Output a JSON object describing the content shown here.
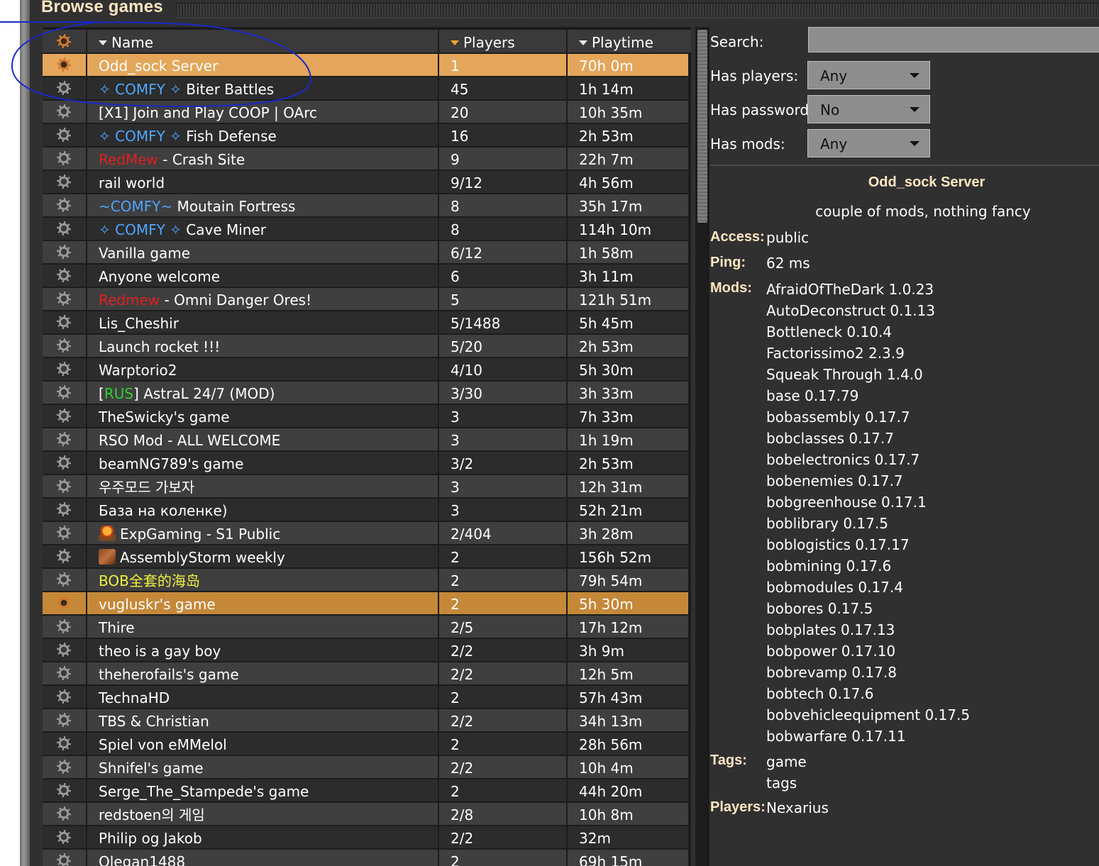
{
  "title": "Browse games",
  "table": {
    "headers": {
      "name": "Name",
      "players": "Players",
      "playtime": "Playtime"
    },
    "rows": [
      {
        "segments": [
          {
            "text": "Odd_sock Server"
          }
        ],
        "players": "1",
        "playtime": "70h 0m",
        "state": "selected"
      },
      {
        "segments": [
          {
            "text": "✧ COMFY ✧",
            "color": "blue"
          },
          {
            "text": " Biter Battles"
          }
        ],
        "players": "45",
        "playtime": "1h 14m"
      },
      {
        "segments": [
          {
            "text": "[X1] Join and Play COOP | OArc"
          }
        ],
        "players": "20",
        "playtime": "10h 35m"
      },
      {
        "segments": [
          {
            "text": "✧ COMFY ✧",
            "color": "blue"
          },
          {
            "text": " Fish Defense"
          }
        ],
        "players": "16",
        "playtime": "2h 53m"
      },
      {
        "segments": [
          {
            "text": "RedMew",
            "color": "red"
          },
          {
            "text": " - Crash Site"
          }
        ],
        "players": "9",
        "playtime": "22h 7m"
      },
      {
        "segments": [
          {
            "text": "rail world"
          }
        ],
        "players": "9/12",
        "playtime": "4h 56m"
      },
      {
        "segments": [
          {
            "text": "~COMFY~",
            "color": "blue"
          },
          {
            "text": " Moutain Fortress"
          }
        ],
        "players": "8",
        "playtime": "35h 17m"
      },
      {
        "segments": [
          {
            "text": "✧ COMFY ✧",
            "color": "blue"
          },
          {
            "text": " Cave Miner"
          }
        ],
        "players": "8",
        "playtime": "114h 10m"
      },
      {
        "segments": [
          {
            "text": "Vanilla game"
          }
        ],
        "players": "6/12",
        "playtime": "1h 58m"
      },
      {
        "segments": [
          {
            "text": "Anyone welcome"
          }
        ],
        "players": "6",
        "playtime": "3h 11m"
      },
      {
        "segments": [
          {
            "text": "Redmew",
            "color": "red"
          },
          {
            "text": " - Omni Danger Ores!"
          }
        ],
        "players": "5",
        "playtime": "121h 51m"
      },
      {
        "segments": [
          {
            "text": "Lis_Cheshir"
          }
        ],
        "players": "5/1488",
        "playtime": "5h 45m"
      },
      {
        "segments": [
          {
            "text": "Launch rocket !!!"
          }
        ],
        "players": "5/20",
        "playtime": "2h 53m"
      },
      {
        "segments": [
          {
            "text": "Warptorio2"
          }
        ],
        "players": "4/10",
        "playtime": "5h 30m"
      },
      {
        "segments": [
          {
            "text": "["
          },
          {
            "text": "RUS",
            "color": "green"
          },
          {
            "text": "] AstraL 24/7 (MOD)"
          }
        ],
        "players": "3/30",
        "playtime": "3h 33m"
      },
      {
        "segments": [
          {
            "text": "TheSwicky's game"
          }
        ],
        "players": "3",
        "playtime": "7h 33m"
      },
      {
        "segments": [
          {
            "text": "RSO Mod - ALL WELCOME"
          }
        ],
        "players": "3",
        "playtime": "1h 19m"
      },
      {
        "segments": [
          {
            "text": "beamNG789's game"
          }
        ],
        "players": "3/2",
        "playtime": "2h 53m"
      },
      {
        "segments": [
          {
            "text": "우주모드 가보자"
          }
        ],
        "players": "3",
        "playtime": "12h 31m"
      },
      {
        "segments": [
          {
            "text": "База на коленке)"
          }
        ],
        "players": "3",
        "playtime": "52h 21m"
      },
      {
        "segments": [
          {
            "icon": "nuke-icon"
          },
          {
            "text": "ExpGaming - S1 Public"
          }
        ],
        "players": "2/404",
        "playtime": "3h 28m"
      },
      {
        "segments": [
          {
            "icon": "crate-icon"
          },
          {
            "text": "AssemblyStorm weekly"
          }
        ],
        "players": "2",
        "playtime": "156h 52m"
      },
      {
        "segments": [
          {
            "text": "BOB全套的海岛",
            "color": "yellow"
          }
        ],
        "players": "2",
        "playtime": "79h 54m"
      },
      {
        "segments": [
          {
            "text": "vugluskr's game"
          }
        ],
        "players": "2",
        "playtime": "5h 30m",
        "state": "hover"
      },
      {
        "segments": [
          {
            "text": "Thire"
          }
        ],
        "players": "2/5",
        "playtime": "17h 12m"
      },
      {
        "segments": [
          {
            "text": "theo is a gay boy"
          }
        ],
        "players": "2/2",
        "playtime": "3h 9m"
      },
      {
        "segments": [
          {
            "text": "theherofails's game"
          }
        ],
        "players": "2/2",
        "playtime": "12h 5m"
      },
      {
        "segments": [
          {
            "text": "TechnaHD"
          }
        ],
        "players": "2",
        "playtime": "57h 43m"
      },
      {
        "segments": [
          {
            "text": "TBS & Christian"
          }
        ],
        "players": "2/2",
        "playtime": "34h 13m"
      },
      {
        "segments": [
          {
            "text": "Spiel von eMMelol"
          }
        ],
        "players": "2",
        "playtime": "28h 56m"
      },
      {
        "segments": [
          {
            "text": "Shnifel's game"
          }
        ],
        "players": "2/2",
        "playtime": "10h 4m"
      },
      {
        "segments": [
          {
            "text": "Serge_The_Stampede's game"
          }
        ],
        "players": "2",
        "playtime": "44h 20m"
      },
      {
        "segments": [
          {
            "text": "redstoen의 게임"
          }
        ],
        "players": "2/8",
        "playtime": "10h 8m"
      },
      {
        "segments": [
          {
            "text": "Philip og Jakob"
          }
        ],
        "players": "2/2",
        "playtime": "32m"
      },
      {
        "segments": [
          {
            "text": "Olegan1488"
          }
        ],
        "players": "2",
        "playtime": "69h 15m"
      }
    ]
  },
  "filters": {
    "search_label": "Search:",
    "search_value": "",
    "has_players_label": "Has players:",
    "has_players_value": "Any",
    "has_password_label": "Has password:",
    "has_password_value": "No",
    "has_mods_label": "Has mods:",
    "has_mods_value": "Any"
  },
  "details": {
    "name": "Odd_sock Server",
    "description": "couple of mods, nothing fancy",
    "access_label": "Access:",
    "access_value": "public",
    "ping_label": "Ping:",
    "ping_value": "62 ms",
    "mods_label": "Mods:",
    "mods": [
      "AfraidOfTheDark 1.0.23",
      "AutoDeconstruct 0.1.13",
      "Bottleneck 0.10.4",
      "Factorissimo2 2.3.9",
      "Squeak Through 1.4.0",
      "base 0.17.79",
      "bobassembly 0.17.7",
      "bobclasses 0.17.7",
      "bobelectronics 0.17.7",
      "bobenemies 0.17.7",
      "bobgreenhouse 0.17.1",
      "boblibrary 0.17.5",
      "boblogistics 0.17.17",
      "bobmining 0.17.6",
      "bobmodules 0.17.4",
      "bobores 0.17.5",
      "bobplates 0.17.13",
      "bobpower 0.17.10",
      "bobrevamp 0.17.8",
      "bobtech 0.17.6",
      "bobvehicleequipment 0.17.5",
      "bobwarfare 0.17.11"
    ],
    "tags_label": "Tags:",
    "tags": [
      "game",
      "tags"
    ],
    "players_label": "Players:",
    "players_value": "Nexarius"
  },
  "colors": {
    "selected_row": "#e4a65a",
    "hover_row": "#c58838",
    "title_text": "#ffe6c0",
    "blue_text": "#4fa6ff",
    "red_text": "#e02020",
    "green_text": "#30d030",
    "yellow_text": "#f0f040",
    "annotation_ink": "#1a28c8"
  }
}
